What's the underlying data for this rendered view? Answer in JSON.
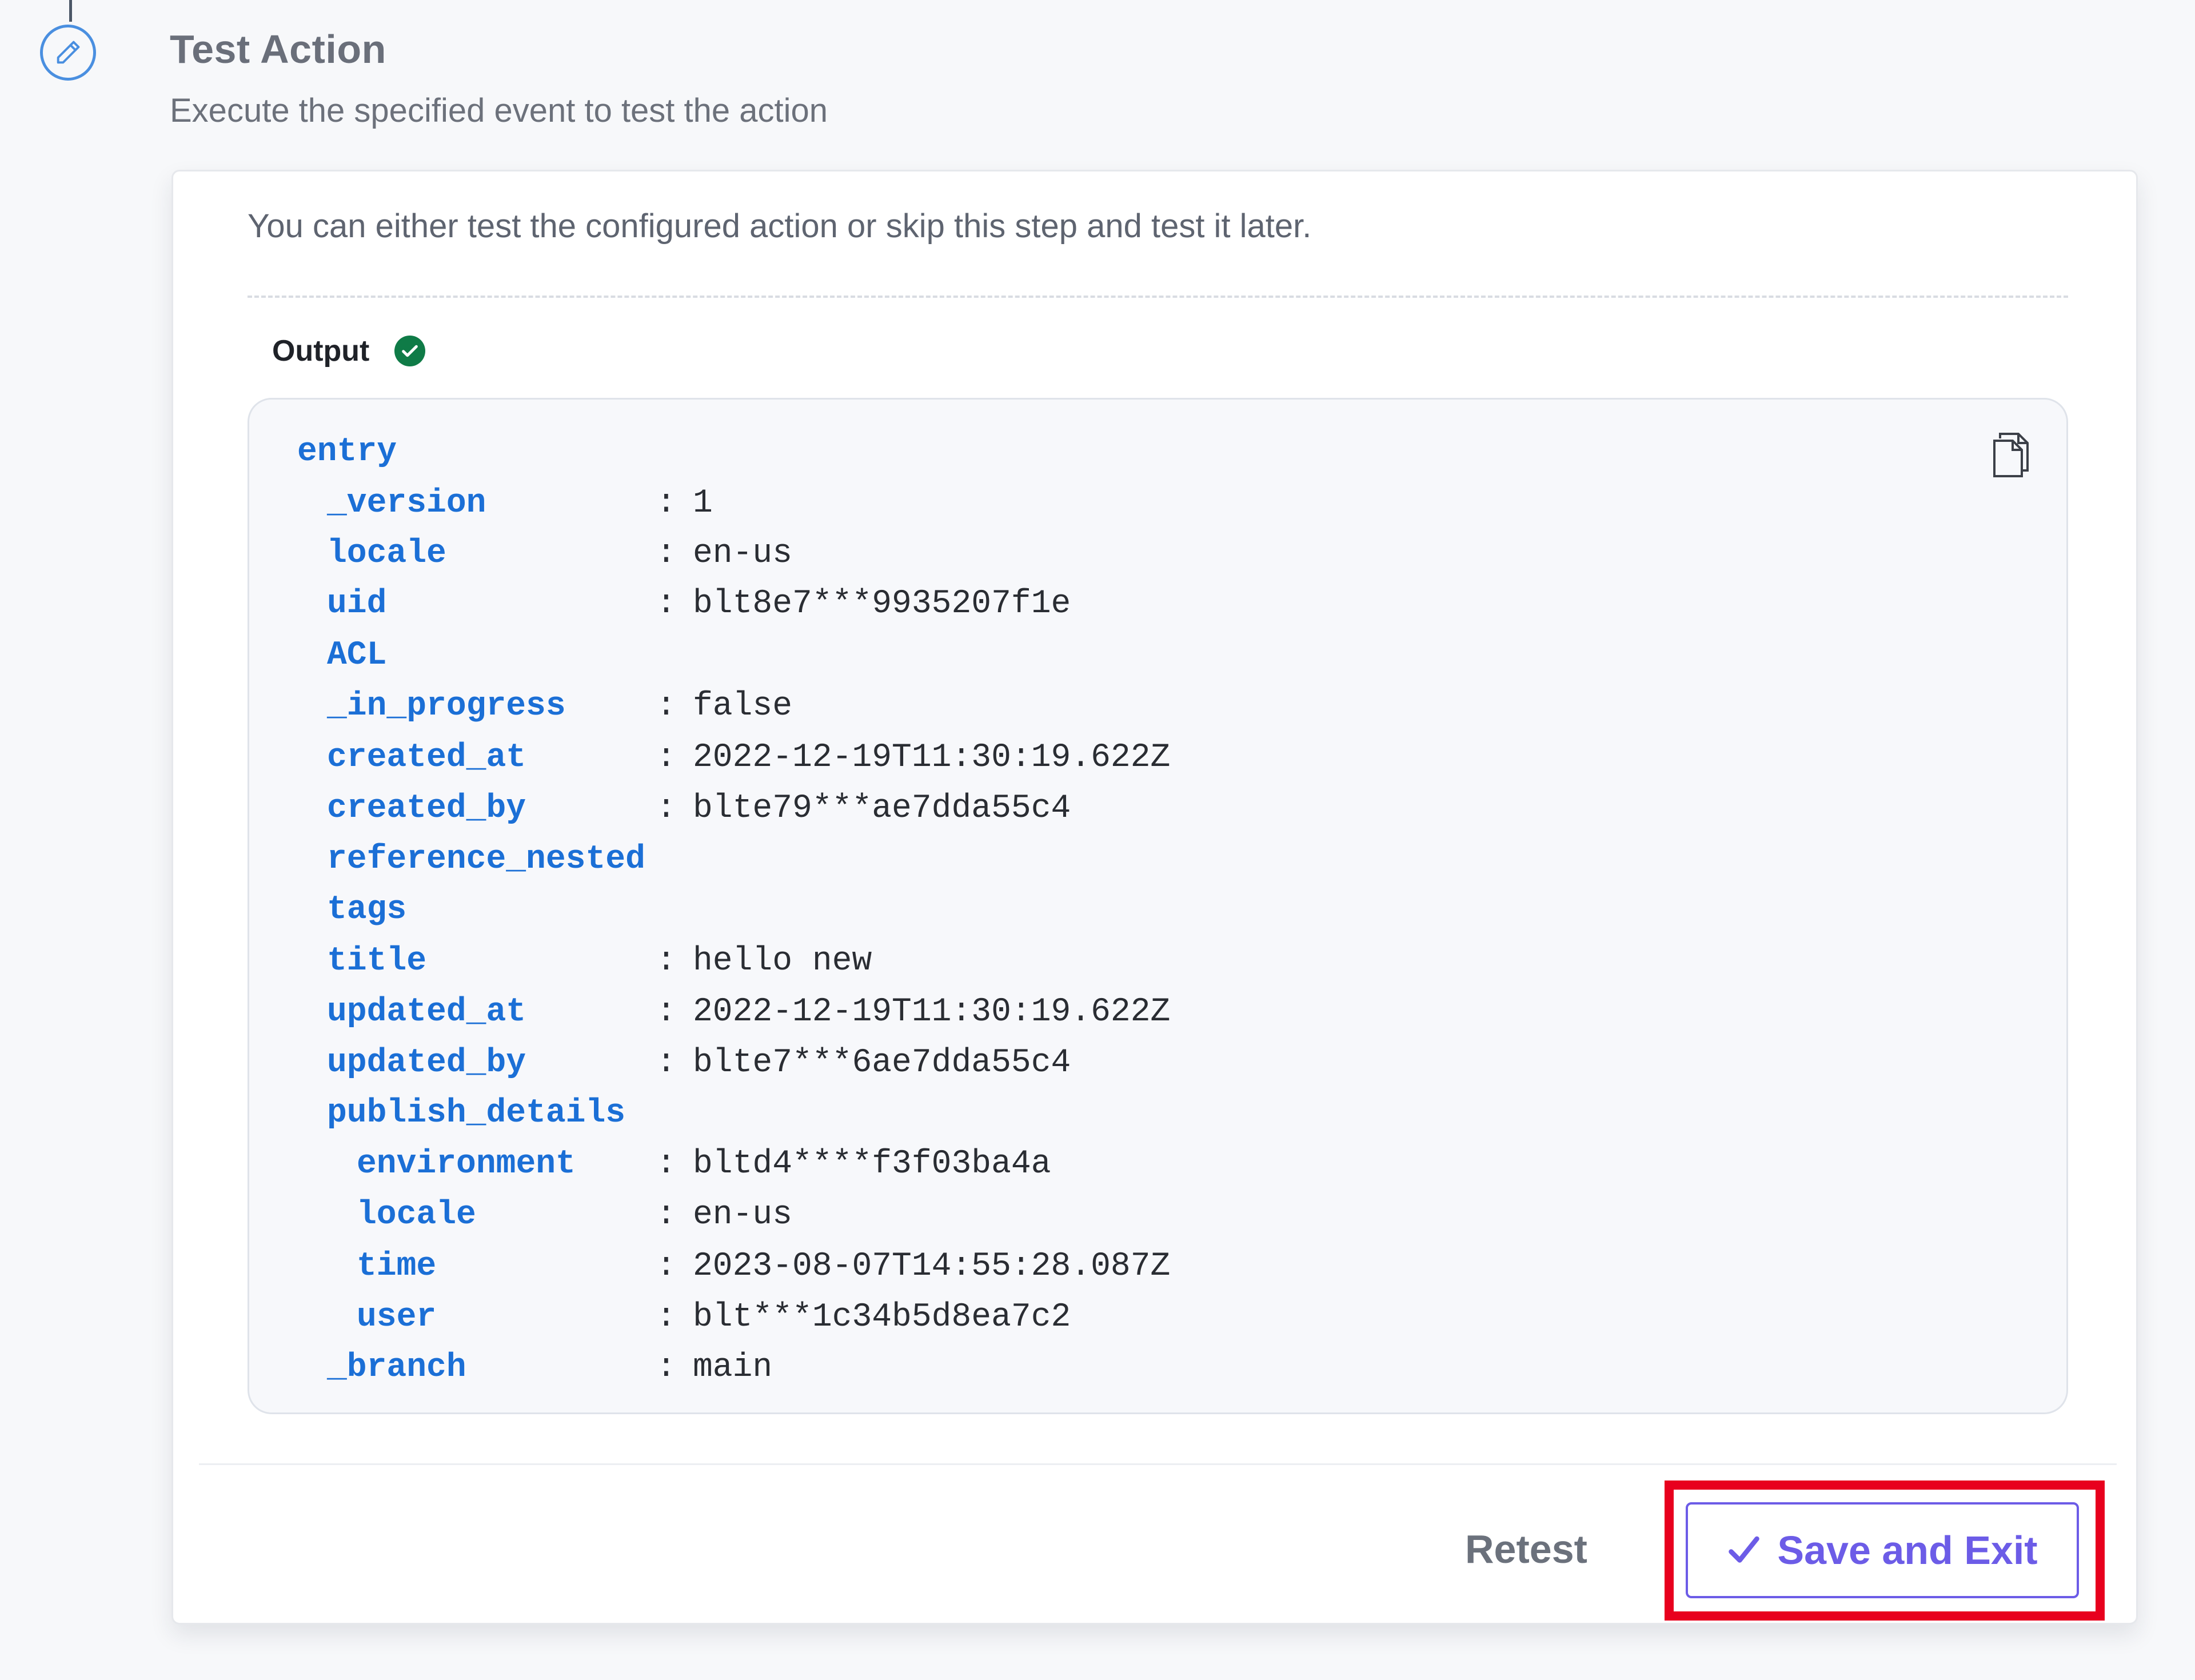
{
  "header": {
    "title": "Test Action",
    "subtitle": "Execute the specified event to test the action",
    "step_icon": "pencil-icon"
  },
  "card": {
    "intro": "You can either test the configured action or skip this step and test it later.",
    "output_label": "Output",
    "output_status": "success",
    "copy_icon": "copy-icon"
  },
  "output": {
    "rows": [
      {
        "key": "entry",
        "value": ""
      },
      {
        "key": "_version",
        "value": "1"
      },
      {
        "key": "locale",
        "value": "en-us"
      },
      {
        "key": "uid",
        "value": "blt8e7***9935207f1e"
      },
      {
        "key": "ACL",
        "value": ""
      },
      {
        "key": "_in_progress",
        "value": "false"
      },
      {
        "key": "created_at",
        "value": "2022-12-19T11:30:19.622Z"
      },
      {
        "key": "created_by",
        "value": "blte79***ae7dda55c4"
      },
      {
        "key": "reference_nested",
        "value": ""
      },
      {
        "key": "tags",
        "value": ""
      },
      {
        "key": "title",
        "value": "hello new"
      },
      {
        "key": "updated_at",
        "value": "2022-12-19T11:30:19.622Z"
      },
      {
        "key": "updated_by",
        "value": "blte7***6ae7dda55c4"
      },
      {
        "key": "publish_details",
        "value": ""
      },
      {
        "key": "environment",
        "value": "bltd4****f3f03ba4a"
      },
      {
        "key": "locale",
        "value": "en-us"
      },
      {
        "key": "time",
        "value": "2023-08-07T14:55:28.087Z"
      },
      {
        "key": "user",
        "value": "blt***1c34b5d8ea7c2"
      },
      {
        "key": "_branch",
        "value": "main"
      }
    ]
  },
  "footer": {
    "retest_label": "Retest",
    "save_label": "Save and Exit"
  },
  "colors": {
    "accent": "#6c5ce7",
    "key": "#1b6fd6",
    "highlight": "#e8001e",
    "success": "#0f7b47"
  }
}
